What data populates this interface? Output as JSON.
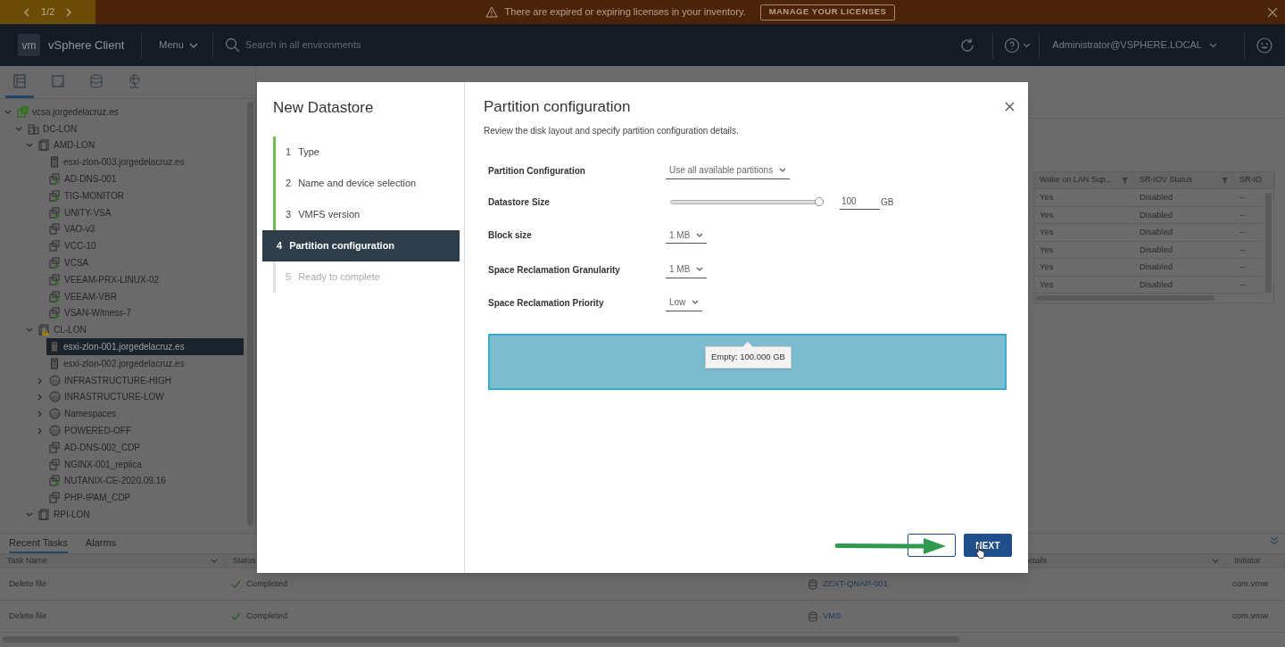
{
  "banner": {
    "pager": "1/2",
    "message": "There are expired or expiring licenses in your inventory.",
    "action": "MANAGE YOUR LICENSES"
  },
  "header": {
    "logo": "vm",
    "app_title": "vSphere Client",
    "menu": "Menu",
    "search": {
      "placeholder": "Search in all environments"
    },
    "user": "Administrator@VSPHERE.LOCAL"
  },
  "sidebar": {
    "tabs": [
      {
        "kind": "hosts",
        "selected": true
      },
      {
        "kind": "vms",
        "selected": false
      },
      {
        "kind": "storage",
        "selected": false
      },
      {
        "kind": "network",
        "selected": false
      }
    ],
    "tree": [
      {
        "label": "vcsa.jorgedelacruz.es",
        "kind": "vcenter",
        "expanded": true,
        "selected": false,
        "children": [
          {
            "label": "DC-LON",
            "kind": "datacenter",
            "expanded": true,
            "selected": false,
            "children": [
              {
                "label": "AMD-LON",
                "kind": "cluster",
                "alert": false,
                "expanded": true,
                "selected": false,
                "children": [
                  {
                    "label": "esxi-zlon-003.jorgedelacruz.es",
                    "kind": "host",
                    "selected": false
                  },
                  {
                    "label": "AD-DNS-001",
                    "kind": "vm",
                    "running": true,
                    "selected": false
                  },
                  {
                    "label": "TIG-MONITOR",
                    "kind": "vm",
                    "running": true,
                    "selected": false
                  },
                  {
                    "label": "UNITY-VSA",
                    "kind": "vm",
                    "running": true,
                    "selected": false
                  },
                  {
                    "label": "VAO-v3",
                    "kind": "vm",
                    "running": false,
                    "selected": false
                  },
                  {
                    "label": "VCC-10",
                    "kind": "vm",
                    "running": false,
                    "selected": false
                  },
                  {
                    "label": "VCSA",
                    "kind": "vm",
                    "running": true,
                    "selected": false
                  },
                  {
                    "label": "VEEAM-PRX-LINUX-02",
                    "kind": "vm",
                    "running": true,
                    "selected": false
                  },
                  {
                    "label": "VEEAM-VBR",
                    "kind": "vm",
                    "running": true,
                    "selected": false
                  },
                  {
                    "label": "VSAN-Witness-7",
                    "kind": "vm",
                    "running": true,
                    "selected": false
                  }
                ]
              },
              {
                "label": "CL-LON",
                "kind": "cluster",
                "alert": true,
                "expanded": true,
                "selected": false,
                "children": [
                  {
                    "label": "esxi-zlon-001.jorgedelacruz.es",
                    "kind": "host",
                    "selected": true
                  },
                  {
                    "label": "esxi-zlon-002.jorgedelacruz.es",
                    "kind": "host",
                    "selected": false
                  },
                  {
                    "label": "INFRASTRUCTURE-HIGH",
                    "kind": "pool",
                    "expanded": false,
                    "selected": false
                  },
                  {
                    "label": "INRASTRUCTURE-LOW",
                    "kind": "pool",
                    "expanded": false,
                    "selected": false
                  },
                  {
                    "label": "Namespaces",
                    "kind": "pool",
                    "expanded": false,
                    "selected": false
                  },
                  {
                    "label": "POWERED-OFF",
                    "kind": "pool",
                    "expanded": false,
                    "selected": false
                  },
                  {
                    "label": "AD-DNS-002_CDP",
                    "kind": "vm",
                    "running": false,
                    "selected": false
                  },
                  {
                    "label": "NGINX-001_replica",
                    "kind": "vm",
                    "running": false,
                    "selected": false
                  },
                  {
                    "label": "NUTANIX-CE-2020.09.16",
                    "kind": "vm",
                    "running": true,
                    "selected": false
                  },
                  {
                    "label": "PHP-IPAM_CDP",
                    "kind": "vm",
                    "running": false,
                    "selected": false
                  }
                ]
              },
              {
                "label": "RPI-LON",
                "kind": "cluster",
                "alert": false,
                "expanded": true,
                "selected": false
              }
            ]
          }
        ]
      }
    ]
  },
  "table": {
    "columns": [
      "Wake on LAN Sup...",
      "SR-IOV Status",
      "SR-IO"
    ],
    "rows": [
      [
        "Yes",
        "Disabled",
        "--"
      ],
      [
        "Yes",
        "Disabled",
        "--"
      ],
      [
        "Yes",
        "Disabled",
        "--"
      ],
      [
        "Yes",
        "Disabled",
        "--"
      ],
      [
        "Yes",
        "Disabled",
        "--"
      ],
      [
        "Yes",
        "Disabled",
        "--"
      ]
    ]
  },
  "tasks_panel": {
    "tabs": [
      {
        "label": "Recent Tasks",
        "selected": true
      },
      {
        "label": "Alarms",
        "selected": false
      }
    ],
    "columns": {
      "task_name": "Task Name",
      "status": "Status",
      "details": "etails",
      "initiator": "Initiator"
    },
    "rows": [
      {
        "task_name": "Delete file",
        "status": "Completed",
        "succeeded": true,
        "target": "ZEXT-QNAP-001",
        "initiator": "com.vmw"
      },
      {
        "task_name": "Delete file",
        "status": "Completed",
        "succeeded": true,
        "target": "VMS",
        "initiator": "com.vmw"
      }
    ]
  },
  "wizard": {
    "title": "New Datastore",
    "steps": [
      {
        "number": "1",
        "label": "Type",
        "completed": true,
        "selected": false,
        "disabled": false
      },
      {
        "number": "2",
        "label": "Name and device selection",
        "completed": true,
        "selected": false,
        "disabled": false
      },
      {
        "number": "3",
        "label": "VMFS version",
        "completed": true,
        "selected": false,
        "disabled": false
      },
      {
        "number": "4",
        "label": "Partition configuration",
        "completed": false,
        "selected": true,
        "disabled": false
      },
      {
        "number": "5",
        "label": "Ready to complete",
        "completed": false,
        "selected": false,
        "disabled": true
      }
    ],
    "page_title": "Partition configuration",
    "description": "Review the disk layout and specify partition configuration details.",
    "fields": [
      {
        "kind": "select",
        "label": "Partition Configuration",
        "value": "Use all available partitions"
      },
      {
        "kind": "slider",
        "label": "Datastore Size",
        "level": 1,
        "value": "100",
        "unit": "GB"
      },
      {
        "kind": "select",
        "label": "Block size",
        "value": "1 MB"
      },
      {
        "kind": "select",
        "label": "Space Reclamation Granularity",
        "value": "1 MB"
      },
      {
        "kind": "select",
        "label": "Space Reclamation Priority",
        "value": "Low"
      }
    ],
    "disk": {
      "tooltip": "Empty: 100.000 GB"
    },
    "buttons": [
      {
        "kind": "secondary"
      },
      {
        "kind": "primary",
        "label": "NEXT"
      }
    ]
  }
}
